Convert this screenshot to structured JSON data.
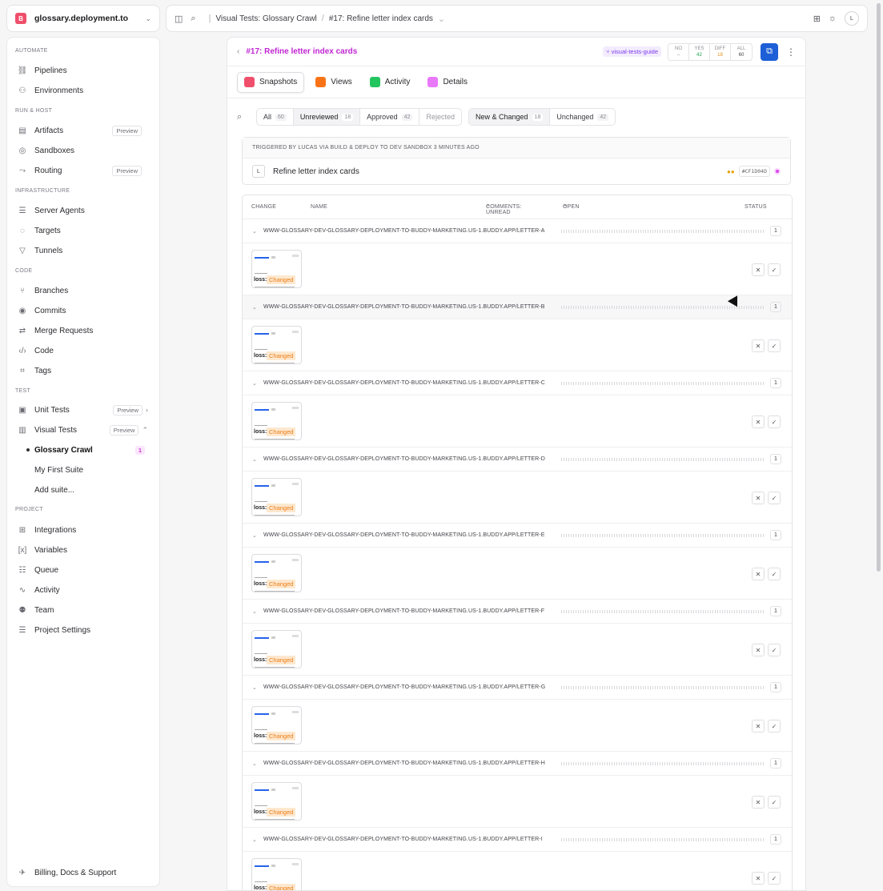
{
  "org": {
    "badge": "B",
    "name": "glossary.deployment.to"
  },
  "sidebar": {
    "sections": {
      "automate": "AUTOMATE",
      "run_host": "RUN & HOST",
      "infrastructure": "INFRASTRUCTURE",
      "code": "CODE",
      "test": "TEST",
      "project": "PROJECT"
    },
    "items": {
      "pipelines": "Pipelines",
      "environments": "Environments",
      "artifacts": "Artifacts",
      "sandboxes": "Sandboxes",
      "routing": "Routing",
      "server_agents": "Server Agents",
      "targets": "Targets",
      "tunnels": "Tunnels",
      "branches": "Branches",
      "commits": "Commits",
      "merge_requests": "Merge Requests",
      "code": "Code",
      "tags": "Tags",
      "unit_tests": "Unit Tests",
      "visual_tests": "Visual Tests",
      "integrations": "Integrations",
      "variables": "Variables",
      "queue": "Queue",
      "activity": "Activity",
      "team": "Team",
      "project_settings": "Project Settings",
      "billing": "Billing, Docs & Support"
    },
    "preview_tag": "Preview",
    "suites": [
      {
        "label": "Glossary Crawl",
        "count": "1"
      },
      {
        "label": "My First Suite"
      },
      {
        "label": "Add suite..."
      }
    ]
  },
  "topbar": {
    "crumbs": [
      "Visual Tests: Glossary Crawl",
      "#17: Refine letter index cards"
    ],
    "avatar": "L"
  },
  "run": {
    "title": "#17: Refine letter index cards",
    "branch": "visual-tests-guide",
    "stats": [
      {
        "label": "NO",
        "value": "–",
        "color": "#8f8f97"
      },
      {
        "label": "YES",
        "value": "42",
        "color": "#16a34a"
      },
      {
        "label": "DIFF",
        "value": "18",
        "color": "#ea8a12"
      },
      {
        "label": "ALL",
        "value": "60",
        "color": "#444444"
      }
    ]
  },
  "tabs": [
    {
      "label": "Snapshots",
      "color": "#ef4f6b"
    },
    {
      "label": "Views",
      "color": "#f97316"
    },
    {
      "label": "Activity",
      "color": "#22c55e"
    },
    {
      "label": "Details",
      "color": "#e879f9"
    }
  ],
  "filters": {
    "status": [
      {
        "label": "All",
        "count": "60"
      },
      {
        "label": "Unreviewed",
        "count": "18"
      },
      {
        "label": "Approved",
        "count": "42"
      },
      {
        "label": "Rejected"
      }
    ],
    "change": [
      {
        "label": "New & Changed",
        "count": "18"
      },
      {
        "label": "Unchanged",
        "count": "42"
      }
    ]
  },
  "trigger": {
    "text": "TRIGGERED BY LUCAS VIA BUILD & DEPLOY TO DEV SANDBOX 3 MINUTES AGO",
    "avatar": "L",
    "message": "Refine letter index cards",
    "sha": "#CF1D04D"
  },
  "table": {
    "headers": {
      "change": "CHANGE",
      "name": "NAME",
      "comments": "COMMENTS: UNREAD",
      "open": "OPEN",
      "status": "STATUS"
    },
    "groups": [
      "WWW-GLOSSARY-DEV-GLOSSARY-DEPLOYMENT-TO-BUDDY-MARKETING.US-1.BUDDY.APP/LETTER-A",
      "WWW-GLOSSARY-DEV-GLOSSARY-DEPLOYMENT-TO-BUDDY-MARKETING.US-1.BUDDY.APP/LETTER-B",
      "WWW-GLOSSARY-DEV-GLOSSARY-DEPLOYMENT-TO-BUDDY-MARKETING.US-1.BUDDY.APP/LETTER-C",
      "WWW-GLOSSARY-DEV-GLOSSARY-DEPLOYMENT-TO-BUDDY-MARKETING.US-1.BUDDY.APP/LETTER-D",
      "WWW-GLOSSARY-DEV-GLOSSARY-DEPLOYMENT-TO-BUDDY-MARKETING.US-1.BUDDY.APP/LETTER-E",
      "WWW-GLOSSARY-DEV-GLOSSARY-DEPLOYMENT-TO-BUDDY-MARKETING.US-1.BUDDY.APP/LETTER-F",
      "WWW-GLOSSARY-DEV-GLOSSARY-DEPLOYMENT-TO-BUDDY-MARKETING.US-1.BUDDY.APP/LETTER-G",
      "WWW-GLOSSARY-DEV-GLOSSARY-DEPLOYMENT-TO-BUDDY-MARKETING.US-1.BUDDY.APP/LETTER-H",
      "WWW-GLOSSARY-DEV-GLOSSARY-DEPLOYMENT-TO-BUDDY-MARKETING.US-1.BUDDY.APP/LETTER-I"
    ],
    "group_count": "1",
    "thumb_word": "loss:",
    "changed_label": "Changed"
  }
}
